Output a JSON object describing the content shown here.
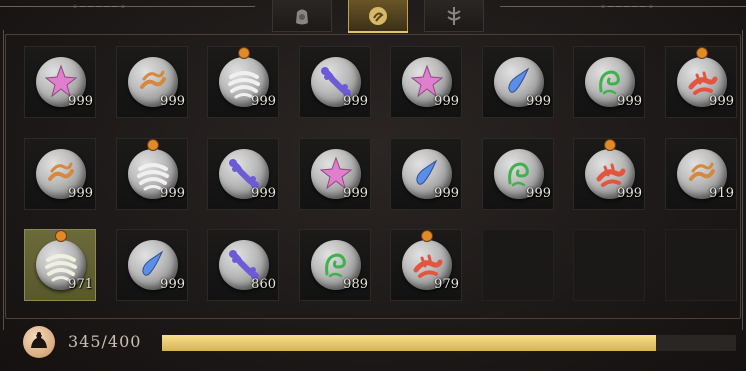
{
  "tabs": [
    {
      "icon": "bag-icon",
      "active": false
    },
    {
      "icon": "rune-stone-icon",
      "active": true
    },
    {
      "icon": "crest-icon",
      "active": false
    }
  ],
  "slots": [
    {
      "glyph": "star",
      "color": "#e07fce",
      "count": "999",
      "tag": false
    },
    {
      "glyph": "wave",
      "color": "#d4893e",
      "count": "999",
      "tag": false
    },
    {
      "glyph": "stripes",
      "color": "#f0f0f0",
      "count": "999",
      "tag": true
    },
    {
      "glyph": "bone",
      "color": "#6b5bd6",
      "count": "999",
      "tag": false
    },
    {
      "glyph": "star",
      "color": "#e07fce",
      "count": "999",
      "tag": false
    },
    {
      "glyph": "drop",
      "color": "#5a8ee8",
      "count": "999",
      "tag": false
    },
    {
      "glyph": "knot",
      "color": "#3fb24e",
      "count": "999",
      "tag": false
    },
    {
      "glyph": "claw",
      "color": "#e2553f",
      "count": "999",
      "tag": true
    },
    {
      "glyph": "wave",
      "color": "#d4893e",
      "count": "999",
      "tag": false
    },
    {
      "glyph": "stripes",
      "color": "#f0f0f0",
      "count": "999",
      "tag": true
    },
    {
      "glyph": "bone",
      "color": "#6b5bd6",
      "count": "999",
      "tag": false
    },
    {
      "glyph": "star",
      "color": "#e07fce",
      "count": "999",
      "tag": false
    },
    {
      "glyph": "drop",
      "color": "#5a8ee8",
      "count": "999",
      "tag": false
    },
    {
      "glyph": "knot",
      "color": "#3fb24e",
      "count": "999",
      "tag": false
    },
    {
      "glyph": "claw",
      "color": "#e2553f",
      "count": "999",
      "tag": true
    },
    {
      "glyph": "wave",
      "color": "#d4893e",
      "count": "919",
      "tag": false
    },
    {
      "glyph": "stripes",
      "color": "#f0f0e0",
      "count": "971",
      "tag": true,
      "selected": true
    },
    {
      "glyph": "drop",
      "color": "#5a8ee8",
      "count": "999",
      "tag": false
    },
    {
      "glyph": "bone",
      "color": "#6b5bd6",
      "count": "860",
      "tag": false
    },
    {
      "glyph": "knot",
      "color": "#3fb24e",
      "count": "989",
      "tag": false
    },
    {
      "glyph": "claw",
      "color": "#e2553f",
      "count": "979",
      "tag": true
    },
    {
      "empty": true
    },
    {
      "empty": true
    },
    {
      "empty": true
    }
  ],
  "weight": {
    "label": "345/400",
    "current": 345,
    "max": 400,
    "icon": "weight-bag-icon"
  },
  "colors": {
    "accent": "#e6c369",
    "bar_fill": "#e9c86d",
    "selected_slot": "#6b6a3a"
  }
}
